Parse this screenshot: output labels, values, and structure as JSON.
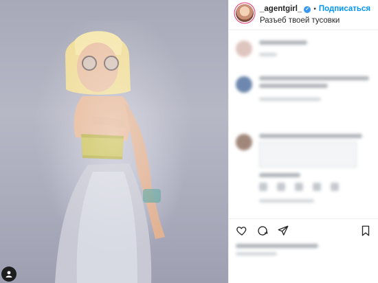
{
  "post": {
    "username": "_agentgirl_",
    "separator": "•",
    "follow_label": "Подписаться",
    "caption": "Разъеб твоей тусовки"
  },
  "colors": {
    "accent": "#0095f6",
    "verified": "#3897f0",
    "text": "#262626",
    "muted": "#8e8e8e"
  },
  "icons": {
    "verified": "verified-badge-icon",
    "like": "heart-icon",
    "comment": "comment-icon",
    "share": "share-icon",
    "save": "bookmark-icon"
  }
}
